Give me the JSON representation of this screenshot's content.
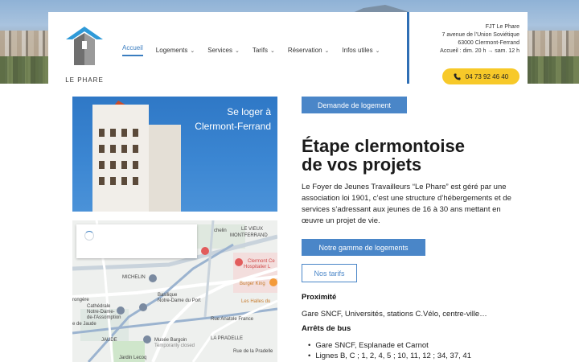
{
  "brand": {
    "name": "LE PHARE"
  },
  "nav": {
    "items": [
      {
        "label": "Accueil",
        "active": true,
        "has_dropdown": false
      },
      {
        "label": "Logements",
        "active": false,
        "has_dropdown": true
      },
      {
        "label": "Services",
        "active": false,
        "has_dropdown": true
      },
      {
        "label": "Tarifs",
        "active": false,
        "has_dropdown": true
      },
      {
        "label": "Réservation",
        "active": false,
        "has_dropdown": true
      },
      {
        "label": "Infos utiles",
        "active": false,
        "has_dropdown": true
      }
    ]
  },
  "contact": {
    "name": "FJT Le Phare",
    "address": "7 avenue de l’Union Soviétique",
    "city": "63000 Clermont-Ferrand",
    "hours": "Accueil : dim. 20 h → sam. 12 h",
    "phone": "04 73 92 46 40"
  },
  "hero": {
    "line1": "Se loger à",
    "line2": "Clermont-Ferrand"
  },
  "map": {
    "labels": {
      "vieux": "LE VIEUX",
      "montferrand": "MONTFERRAND",
      "michelin_top": "chelin",
      "hospital": "Clermont Ce",
      "hospital2": "Hospitalier L",
      "burger": "Burger King",
      "halles": "Les Halles du",
      "michelin": "MICHELIN",
      "basilique": "Basilique",
      "basilique2": "Notre-Dame du Port",
      "cathedrale": "Cathédrale",
      "cathedrale2": "Notre-Dame-",
      "cathedrale3": "de-l'Assomption",
      "jaude_top": "e de Jaude",
      "jaude": "JAUDE",
      "musee": "Musée Bargoin",
      "musee2": "Temporarily closed",
      "pradelle": "LA PRADELLE",
      "jardin": "Jardin Lecoq",
      "rue": "Rue Anatole France",
      "rue2": "Rue de la Pradelle",
      "torgy": "rongère"
    }
  },
  "actions": {
    "request": "Demande de logement",
    "range": "Notre gamme de logements",
    "prices": "Nos tarifs"
  },
  "content": {
    "title_line1": "Étape clermontoise",
    "title_line2": "de vos projets",
    "intro": "Le Foyer de Jeunes Travailleurs “Le Phare” est géré par une association loi 1901, c’est une structure d’hébergements et de services s’adressant aux jeunes de 16 à 30 ans mettant en œuvre un projet de vie.",
    "proximity_title": "Proximité",
    "proximity_text": "Gare SNCF, Universités, stations C.Vélo, centre-ville…",
    "bus_title": "Arrêts de bus",
    "bus_items": [
      "Gare SNCF, Esplanade et Carnot",
      "Lignes B, C ; 1, 2, 4, 5 ; 10, 11, 12 ; 34, 37, 41"
    ]
  },
  "colors": {
    "accent": "#4a86c8",
    "phone_button": "#f7c929",
    "contact_border": "#2f6fb5"
  }
}
